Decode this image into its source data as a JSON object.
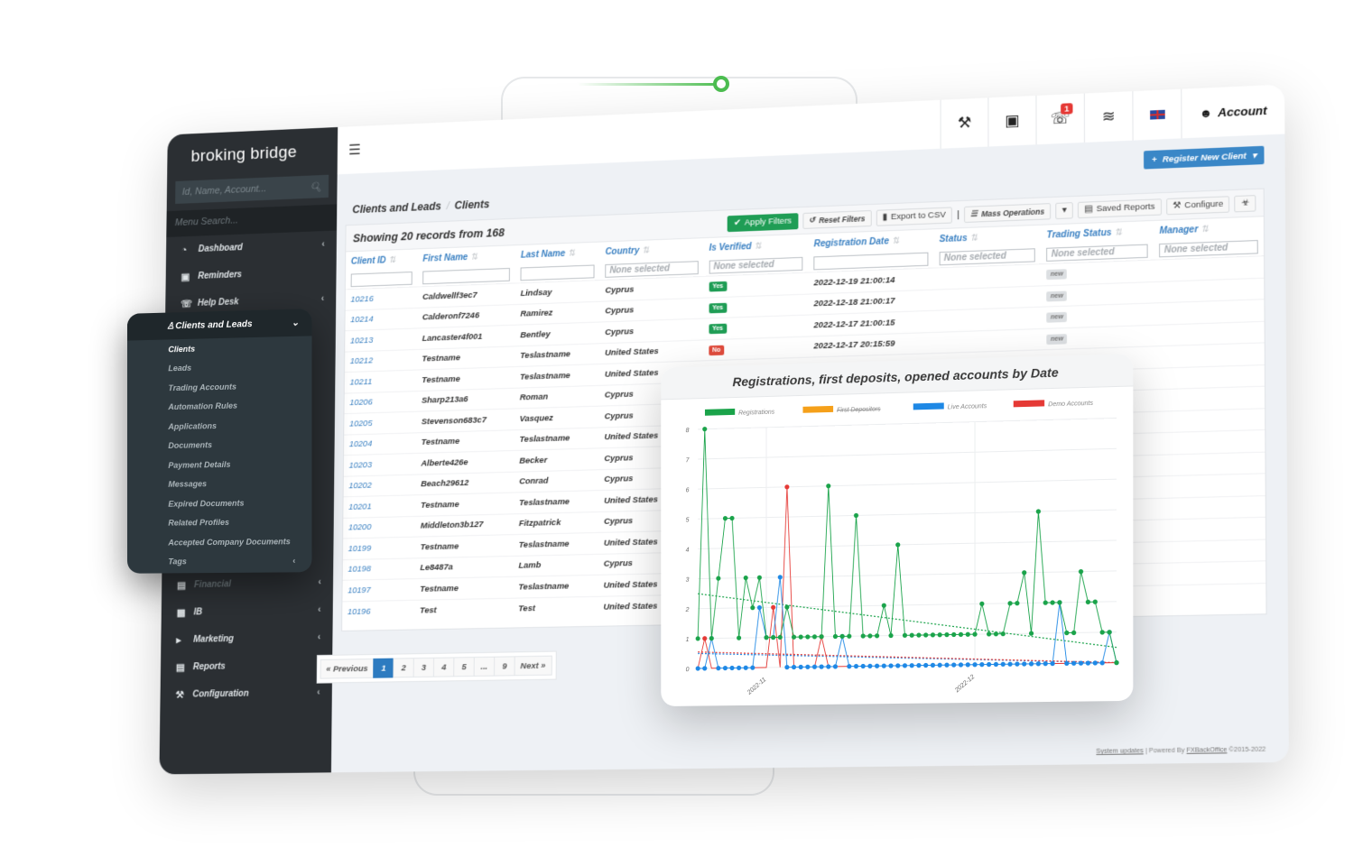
{
  "brand": "broking bridge",
  "sidebar": {
    "quick_search_placeholder": "Id, Name, Account...",
    "menu_search_placeholder": "Menu Search...",
    "items": [
      {
        "label": "Dashboard",
        "icon": "dashboard-icon",
        "has_children": true
      },
      {
        "label": "Reminders",
        "icon": "calendar-icon",
        "has_children": false
      },
      {
        "label": "Help Desk",
        "icon": "headset-icon",
        "has_children": true
      },
      {
        "label": "Clients and Leads",
        "icon": "user-icon",
        "has_children": true,
        "expanded": true
      },
      {
        "label": "Financial",
        "icon": "money-icon",
        "has_children": true
      },
      {
        "label": "IB",
        "icon": "briefcase-icon",
        "has_children": true
      },
      {
        "label": "Marketing",
        "icon": "megaphone-icon",
        "has_children": true
      },
      {
        "label": "Reports",
        "icon": "chart-icon",
        "has_children": true
      },
      {
        "label": "Configuration",
        "icon": "wrench-icon",
        "has_children": true
      }
    ],
    "submenu": {
      "title": "Clients and Leads",
      "items": [
        "Clients",
        "Leads",
        "Trading Accounts",
        "Automation Rules",
        "Applications",
        "Documents",
        "Payment Details",
        "Messages",
        "Expired Documents",
        "Related Profiles",
        "Accepted Company Documents",
        "Tags"
      ],
      "active": "Clients"
    }
  },
  "topbar": {
    "icons": [
      "puzzle-icon",
      "calendar-icon",
      "headset-icon",
      "rss-icon",
      "uk-flag-icon"
    ],
    "notification_count": "1",
    "account_label": "Account"
  },
  "register_button": "Register New Client",
  "breadcrumb": [
    "Clients and Leads",
    "Clients"
  ],
  "toolbar": {
    "showing": "Showing 20 records from 168",
    "apply_filters": "Apply Filters",
    "reset_filters": "Reset Filters",
    "export_csv": "Export to CSV",
    "mass_operations": "Mass Operations",
    "saved_reports": "Saved Reports",
    "configure": "Configure"
  },
  "table": {
    "columns": [
      "Client ID",
      "First Name",
      "Last Name",
      "Country",
      "Is Verified",
      "Registration Date",
      "Status",
      "Trading Status",
      "Manager"
    ],
    "filter_placeholder": "None selected",
    "rows": [
      {
        "id": "10216",
        "first": "Caldwellf3ec7",
        "last": "Lindsay",
        "country": "Cyprus",
        "verified": "Yes",
        "date": "2022-12-19 21:00:14",
        "status": "",
        "trading": "new",
        "manager": ""
      },
      {
        "id": "10214",
        "first": "Calderonf7246",
        "last": "Ramirez",
        "country": "Cyprus",
        "verified": "Yes",
        "date": "2022-12-18 21:00:17",
        "status": "",
        "trading": "new",
        "manager": ""
      },
      {
        "id": "10213",
        "first": "Lancaster4f001",
        "last": "Bentley",
        "country": "Cyprus",
        "verified": "Yes",
        "date": "2022-12-17 21:00:15",
        "status": "",
        "trading": "new",
        "manager": ""
      },
      {
        "id": "10212",
        "first": "Testname",
        "last": "Teslastname",
        "country": "United States",
        "verified": "No",
        "date": "2022-12-17 20:15:59",
        "status": "",
        "trading": "new",
        "manager": ""
      },
      {
        "id": "10211",
        "first": "Testname",
        "last": "Teslastname",
        "country": "United States",
        "verified": "",
        "date": "",
        "status": "",
        "trading": "",
        "manager": ""
      },
      {
        "id": "10206",
        "first": "Sharp213a6",
        "last": "Roman",
        "country": "Cyprus",
        "verified": "",
        "date": "",
        "status": "",
        "trading": "",
        "manager": ""
      },
      {
        "id": "10205",
        "first": "Stevenson683c7",
        "last": "Vasquez",
        "country": "Cyprus",
        "verified": "",
        "date": "",
        "status": "",
        "trading": "",
        "manager": ""
      },
      {
        "id": "10204",
        "first": "Testname",
        "last": "Teslastname",
        "country": "United States",
        "verified": "",
        "date": "",
        "status": "",
        "trading": "",
        "manager": ""
      },
      {
        "id": "10203",
        "first": "Alberte426e",
        "last": "Becker",
        "country": "Cyprus",
        "verified": "",
        "date": "",
        "status": "",
        "trading": "",
        "manager": ""
      },
      {
        "id": "10202",
        "first": "Beach29612",
        "last": "Conrad",
        "country": "Cyprus",
        "verified": "",
        "date": "",
        "status": "",
        "trading": "",
        "manager": ""
      },
      {
        "id": "10201",
        "first": "Testname",
        "last": "Teslastname",
        "country": "United States",
        "verified": "",
        "date": "",
        "status": "",
        "trading": "",
        "manager": ""
      },
      {
        "id": "10200",
        "first": "Middleton3b127",
        "last": "Fitzpatrick",
        "country": "Cyprus",
        "verified": "",
        "date": "",
        "status": "",
        "trading": "",
        "manager": ""
      },
      {
        "id": "10199",
        "first": "Testname",
        "last": "Teslastname",
        "country": "United States",
        "verified": "",
        "date": "",
        "status": "",
        "trading": "",
        "manager": ""
      },
      {
        "id": "10198",
        "first": "Le8487a",
        "last": "Lamb",
        "country": "Cyprus",
        "verified": "",
        "date": "",
        "status": "",
        "trading": "",
        "manager": ""
      },
      {
        "id": "10197",
        "first": "Testname",
        "last": "Teslastname",
        "country": "United States",
        "verified": "",
        "date": "",
        "status": "",
        "trading": "",
        "manager": ""
      },
      {
        "id": "10196",
        "first": "Test",
        "last": "Test",
        "country": "United States",
        "verified": "",
        "date": "",
        "status": "",
        "trading": "",
        "manager": ""
      }
    ]
  },
  "pagination": {
    "previous": "« Previous",
    "pages": [
      "1",
      "2",
      "3",
      "4",
      "5",
      "...",
      "9"
    ],
    "active": "1",
    "next": "Next »"
  },
  "footer": {
    "system_updates": "System updates",
    "powered_by": "Powered By",
    "vendor": "FXBackOffice",
    "copyright": "©2015-2022"
  },
  "colors": {
    "accent": "#3a87c7",
    "sidebar_bg": "#2b2f33",
    "success": "#1f9d55",
    "danger": "#e04b3c"
  },
  "chart_data": {
    "type": "line",
    "title": "Registrations, first deposits, opened accounts by Date",
    "xlabel": "",
    "ylabel": "",
    "ylim": [
      0,
      8
    ],
    "yticks": [
      0,
      1,
      2,
      3,
      4,
      5,
      6,
      7,
      8
    ],
    "xtick_labels": [
      {
        "index": 10,
        "label": "2022-11"
      },
      {
        "index": 40,
        "label": "2022-12"
      }
    ],
    "legend": "top",
    "grid": true,
    "series": [
      {
        "name": "Registrations",
        "color": "#1aa34a",
        "hidden": false,
        "values": [
          1,
          8,
          1,
          3,
          5,
          5,
          1,
          3,
          2,
          3,
          1,
          1,
          1,
          2,
          1,
          1,
          1,
          1,
          1,
          6,
          1,
          1,
          1,
          5,
          1,
          1,
          1,
          2,
          1,
          4,
          1,
          1,
          1,
          1,
          1,
          1,
          1,
          1,
          1,
          1,
          1,
          2,
          1,
          1,
          1,
          2,
          2,
          3,
          1,
          5,
          2,
          2,
          2,
          1,
          1,
          3,
          2,
          2,
          1,
          1,
          0
        ]
      },
      {
        "name": "First Depositors",
        "color": "#f5a01a",
        "hidden": true,
        "values": []
      },
      {
        "name": "Live Accounts",
        "color": "#1e88e5",
        "hidden": false,
        "values": [
          0,
          0,
          1,
          0,
          0,
          0,
          0,
          0,
          0,
          2,
          1,
          1,
          3,
          0,
          0,
          0,
          0,
          0,
          0,
          0,
          0,
          1,
          0,
          0,
          0,
          0,
          0,
          0,
          0,
          0,
          0,
          0,
          0,
          0,
          0,
          0,
          0,
          0,
          0,
          0,
          0,
          0,
          0,
          0,
          0,
          0,
          0,
          0,
          0,
          0,
          0,
          0,
          2,
          0,
          0,
          0,
          0,
          0,
          0,
          1,
          0
        ]
      },
      {
        "name": "Demo Accounts",
        "color": "#e53935",
        "hidden": false,
        "values": [
          0,
          1,
          0,
          0,
          0,
          0,
          0,
          0,
          0,
          0,
          0,
          2,
          0,
          6,
          0,
          0,
          0,
          0,
          1,
          0,
          0,
          0,
          0,
          0,
          0,
          0,
          0,
          0,
          0,
          0,
          0,
          0,
          0,
          0,
          0,
          0,
          0,
          0,
          0,
          0,
          0,
          0,
          0,
          0,
          0,
          0,
          0,
          0,
          0,
          0,
          0,
          0,
          0,
          0,
          0,
          0,
          0,
          0,
          0,
          0,
          0
        ]
      }
    ],
    "trendlines": [
      {
        "series": "Registrations",
        "start": 2.5,
        "end": 0.5
      },
      {
        "series": "Live Accounts",
        "start": 0.5,
        "end": 0.0
      },
      {
        "series": "Demo Accounts",
        "start": 0.55,
        "end": 0.0
      }
    ]
  }
}
